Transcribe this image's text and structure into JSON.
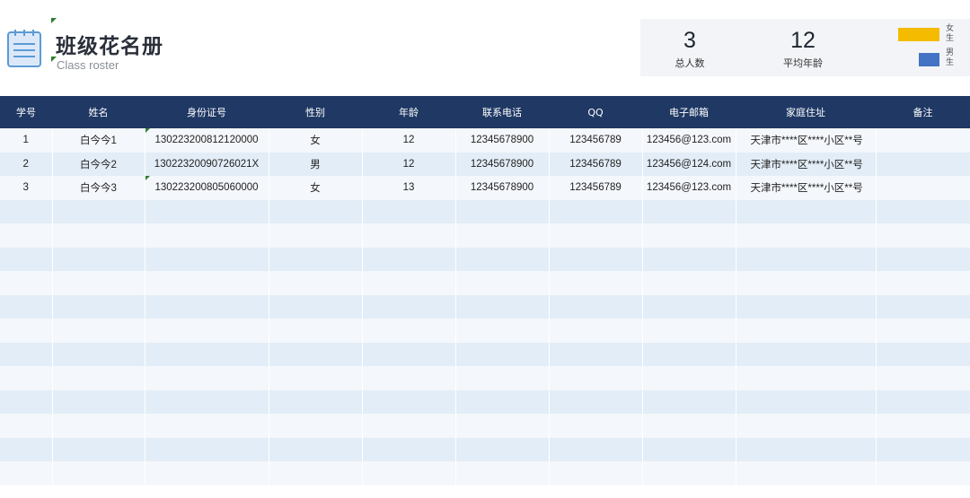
{
  "header": {
    "title": "班级花名册",
    "subtitle": "Class roster"
  },
  "stats": {
    "total": {
      "value": "3",
      "label": "总人数"
    },
    "avg_age": {
      "value": "12",
      "label": "平均年龄"
    }
  },
  "legend": {
    "female": {
      "label": "女生",
      "color": "#f5bb00"
    },
    "male": {
      "label": "男生",
      "color": "#4472c4"
    }
  },
  "table": {
    "columns": [
      "学号",
      "姓名",
      "身份证号",
      "性别",
      "年龄",
      "联系电话",
      "QQ",
      "电子邮箱",
      "家庭住址",
      "备注"
    ],
    "rows": [
      [
        "1",
        "白今今1",
        "130223200812120000",
        "女",
        "12",
        "12345678900",
        "123456789",
        "123456@123.com",
        "天津市****区****小区**号",
        ""
      ],
      [
        "2",
        "白今今2",
        "13022320090726021X",
        "男",
        "12",
        "12345678900",
        "123456789",
        "123456@124.com",
        "天津市****区****小区**号",
        ""
      ],
      [
        "3",
        "白今今3",
        "130223200805060000",
        "女",
        "13",
        "12345678900",
        "123456789",
        "123456@123.com",
        "天津市****区****小区**号",
        ""
      ]
    ]
  },
  "colors": {
    "header_bg": "#1f3864",
    "row_light": "#f4f7fb",
    "row_band": "#e3edf7"
  }
}
